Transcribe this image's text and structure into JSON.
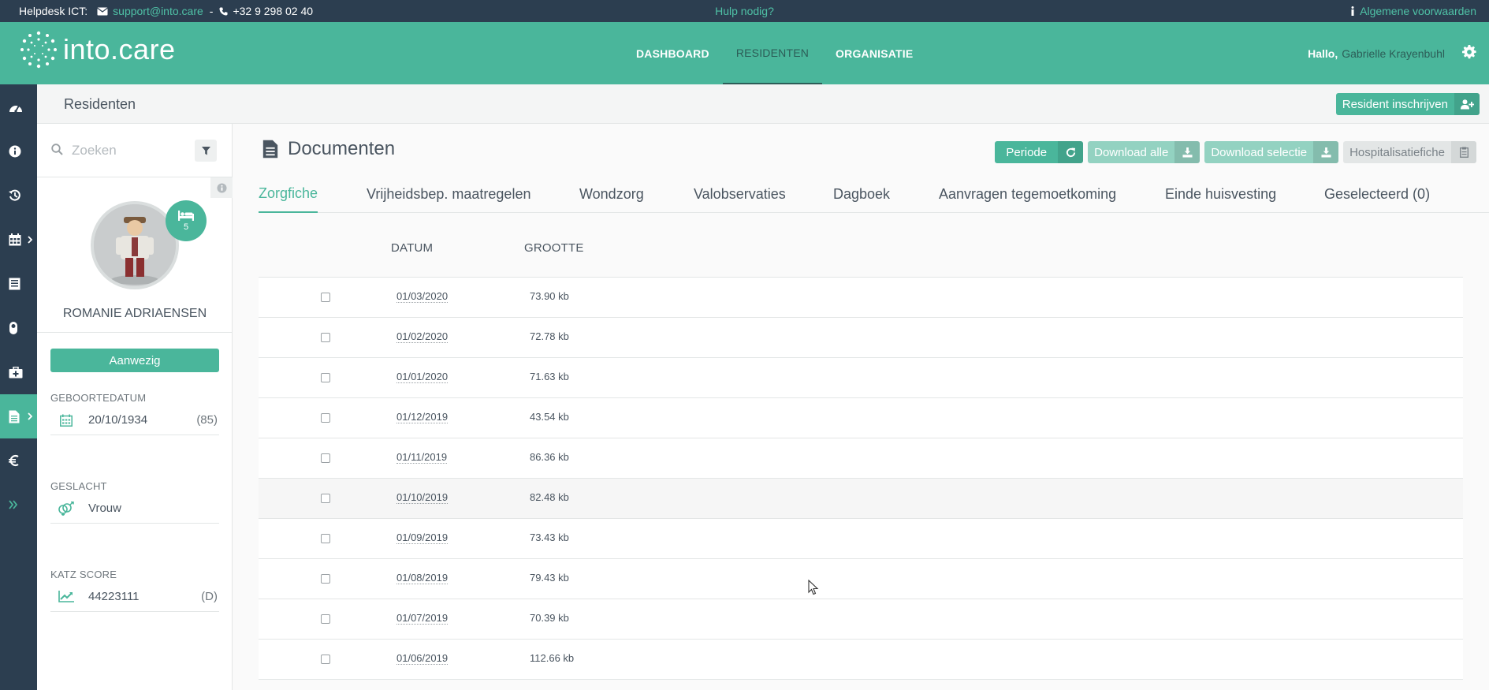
{
  "topbar": {
    "helpdesk_label": "Helpdesk ICT:",
    "email": "support@into.care",
    "separator": "-",
    "phone": "+32 9 298 02 40",
    "help": "Hulp nodig?",
    "terms": "Algemene voorwaarden"
  },
  "header": {
    "logo_text": "into.care",
    "nav": [
      {
        "label": "DASHBOARD",
        "active": false
      },
      {
        "label": "RESIDENTEN",
        "active": true
      },
      {
        "label": "ORGANISATIE",
        "active": false
      }
    ],
    "greeting": "Hallo,",
    "user_name": "Gabrielle Krayenbuhl"
  },
  "rail": {
    "items": [
      {
        "name": "rail-dashboard",
        "icon": "dashboard-icon"
      },
      {
        "name": "rail-info",
        "icon": "info-icon"
      },
      {
        "name": "rail-history",
        "icon": "history-icon"
      },
      {
        "name": "rail-calendar",
        "icon": "calendar-icon"
      },
      {
        "name": "rail-list",
        "icon": "list-icon"
      },
      {
        "name": "rail-medication",
        "icon": "pill-icon"
      },
      {
        "name": "rail-medical",
        "icon": "medical-kit-icon"
      },
      {
        "name": "rail-documents",
        "icon": "document-icon",
        "active": true
      },
      {
        "name": "rail-finance",
        "icon": "euro-icon"
      },
      {
        "name": "rail-expand",
        "icon": "double-chevron-right-icon"
      }
    ]
  },
  "breadcrumb": {
    "title": "Residenten",
    "register_button": "Resident inschrijven"
  },
  "resident": {
    "search_placeholder": "Zoeken",
    "bed_number": "5",
    "name": "ROMANIE ADRIAENSEN",
    "status": "Aanwezig",
    "birthdate_label": "GEBOORTEDATUM",
    "birthdate": "20/10/1934",
    "age": "(85)",
    "gender_label": "GESLACHT",
    "gender": "Vrouw",
    "katz_label": "KATZ SCORE",
    "katz": "44223111",
    "katz_class": "(D)"
  },
  "documents": {
    "title": "Documenten",
    "actions": {
      "period": "Periode",
      "download_all": "Download alle",
      "download_selection": "Download selectie",
      "hospital_sheet": "Hospitalisatiefiche"
    },
    "tabs": [
      {
        "label": "Zorgfiche",
        "active": true
      },
      {
        "label": "Vrijheidsbep. maatregelen"
      },
      {
        "label": "Wondzorg"
      },
      {
        "label": "Valobservaties"
      },
      {
        "label": "Dagboek"
      },
      {
        "label": "Aanvragen tegemoetkoming"
      },
      {
        "label": "Einde huisvesting"
      },
      {
        "label": "Geselecteerd (0)"
      }
    ],
    "columns": {
      "date": "DATUM",
      "size": "GROOTTE"
    },
    "rows": [
      {
        "date": "01/03/2020",
        "size": "73.90 kb"
      },
      {
        "date": "01/02/2020",
        "size": "72.78 kb"
      },
      {
        "date": "01/01/2020",
        "size": "71.63 kb"
      },
      {
        "date": "01/12/2019",
        "size": "43.54 kb"
      },
      {
        "date": "01/11/2019",
        "size": "86.36 kb"
      },
      {
        "date": "01/10/2019",
        "size": "82.48 kb"
      },
      {
        "date": "01/09/2019",
        "size": "73.43 kb"
      },
      {
        "date": "01/08/2019",
        "size": "79.43 kb"
      },
      {
        "date": "01/07/2019",
        "size": "70.39 kb"
      },
      {
        "date": "01/06/2019",
        "size": "112.66 kb"
      }
    ]
  },
  "colors": {
    "brand_green": "#4ab69b",
    "dark_navy": "#2c3e50"
  }
}
